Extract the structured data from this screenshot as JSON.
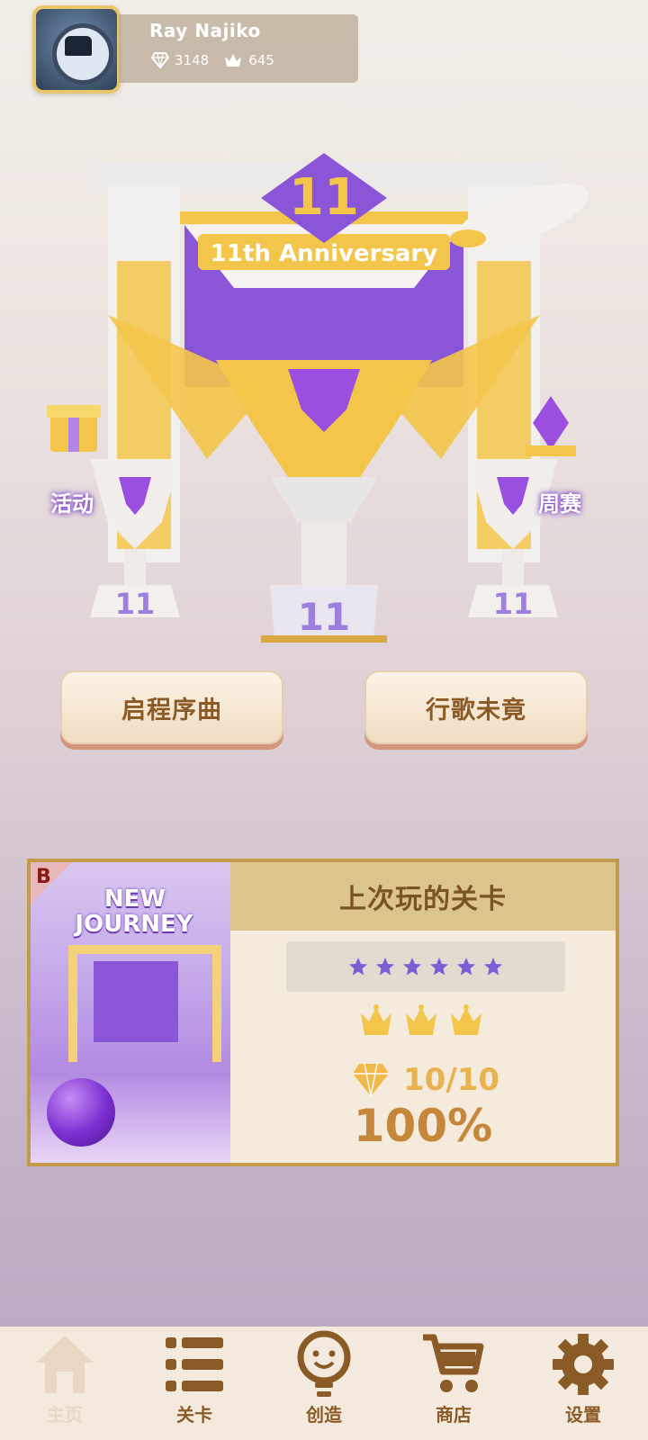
{
  "player": {
    "name": "Ray Najiko",
    "diamonds": "3148",
    "crowns": "645"
  },
  "scene": {
    "banner": "11th Anniversary",
    "trophy_number": "11",
    "left_label": "活动",
    "right_label": "周赛"
  },
  "buttons": {
    "left": "启程序曲",
    "right": "行歌未竟"
  },
  "last_played": {
    "header": "上次玩的关卡",
    "badge": "B",
    "thumb_title_line1": "NEW",
    "thumb_title_line2": "JOURNEY",
    "stars": 6,
    "crowns": 3,
    "gems": "10/10",
    "percent": "100%"
  },
  "nav": {
    "items": [
      {
        "label": "主页",
        "icon": "home-icon",
        "active": false
      },
      {
        "label": "关卡",
        "icon": "list-icon",
        "active": true
      },
      {
        "label": "创造",
        "icon": "lightbulb-icon",
        "active": true
      },
      {
        "label": "商店",
        "icon": "cart-icon",
        "active": true
      },
      {
        "label": "设置",
        "icon": "gear-icon",
        "active": true
      }
    ]
  },
  "colors": {
    "accent_brown": "#8a5a27",
    "gold": "#e8b24e",
    "purple": "#7d45c7",
    "star_purple": "#7b5ed6"
  }
}
